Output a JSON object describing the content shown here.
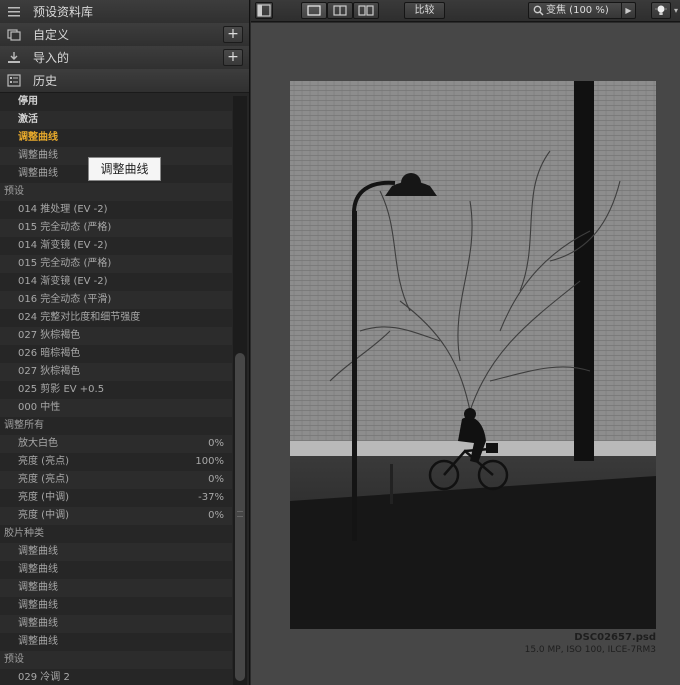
{
  "sidebar": {
    "presets_library": {
      "label": "预设资料库"
    },
    "custom": {
      "label": "自定义"
    },
    "imported": {
      "label": "导入的"
    },
    "history": {
      "label": "历史"
    },
    "add_label": "+"
  },
  "history_items": [
    {
      "text": "停用",
      "style": "bold"
    },
    {
      "text": "激活",
      "style": "bold"
    },
    {
      "text": "调整曲线",
      "style": "active"
    },
    {
      "text": "调整曲线",
      "style": "item"
    },
    {
      "text": "调整曲线",
      "style": "item"
    },
    {
      "text": "预设",
      "style": "group"
    },
    {
      "text": "014 推处理 (EV -2)",
      "style": "item"
    },
    {
      "text": "015 完全动态 (严格)",
      "style": "item"
    },
    {
      "text": "014 渐变镜 (EV -2)",
      "style": "item"
    },
    {
      "text": "015 完全动态 (严格)",
      "style": "item"
    },
    {
      "text": "014 渐变镜 (EV -2)",
      "style": "item"
    },
    {
      "text": "016 完全动态 (平滑)",
      "style": "item"
    },
    {
      "text": "024 完整对比度和细节强度",
      "style": "item"
    },
    {
      "text": "027 狄棕褐色",
      "style": "item"
    },
    {
      "text": "026 暗棕褐色",
      "style": "item"
    },
    {
      "text": "027 狄棕褐色",
      "style": "item"
    },
    {
      "text": "025 剪影 EV +0.5",
      "style": "item"
    },
    {
      "text": "000 中性",
      "style": "item"
    },
    {
      "text": "调整所有",
      "style": "group"
    },
    {
      "text": "放大白色",
      "value": "0%",
      "style": "item"
    },
    {
      "text": "亮度 (亮点)",
      "value": "100%",
      "style": "item"
    },
    {
      "text": "亮度 (亮点)",
      "value": "0%",
      "style": "item"
    },
    {
      "text": "亮度 (中调)",
      "value": "-37%",
      "style": "item"
    },
    {
      "text": "亮度 (中调)",
      "value": "0%",
      "style": "item"
    },
    {
      "text": "胶片种类",
      "style": "group"
    },
    {
      "text": "调整曲线",
      "style": "item"
    },
    {
      "text": "调整曲线",
      "style": "item"
    },
    {
      "text": "调整曲线",
      "style": "item"
    },
    {
      "text": "调整曲线",
      "style": "item"
    },
    {
      "text": "调整曲线",
      "style": "item"
    },
    {
      "text": "调整曲线",
      "style": "item"
    },
    {
      "text": "预设",
      "style": "group"
    },
    {
      "text": "029 冷调 2",
      "style": "item"
    }
  ],
  "tooltip": {
    "text": "调整曲线"
  },
  "toolbar": {
    "compare_label": "比较",
    "zoom_label": "变焦 (100 %)"
  },
  "photo": {
    "filename": "DSC02657.psd",
    "info": "15.0 MP, ISO 100, ILCE-7RM3"
  },
  "colors": {
    "active": "#e6a82b",
    "panel": "#262626",
    "viewer": "#474747"
  }
}
